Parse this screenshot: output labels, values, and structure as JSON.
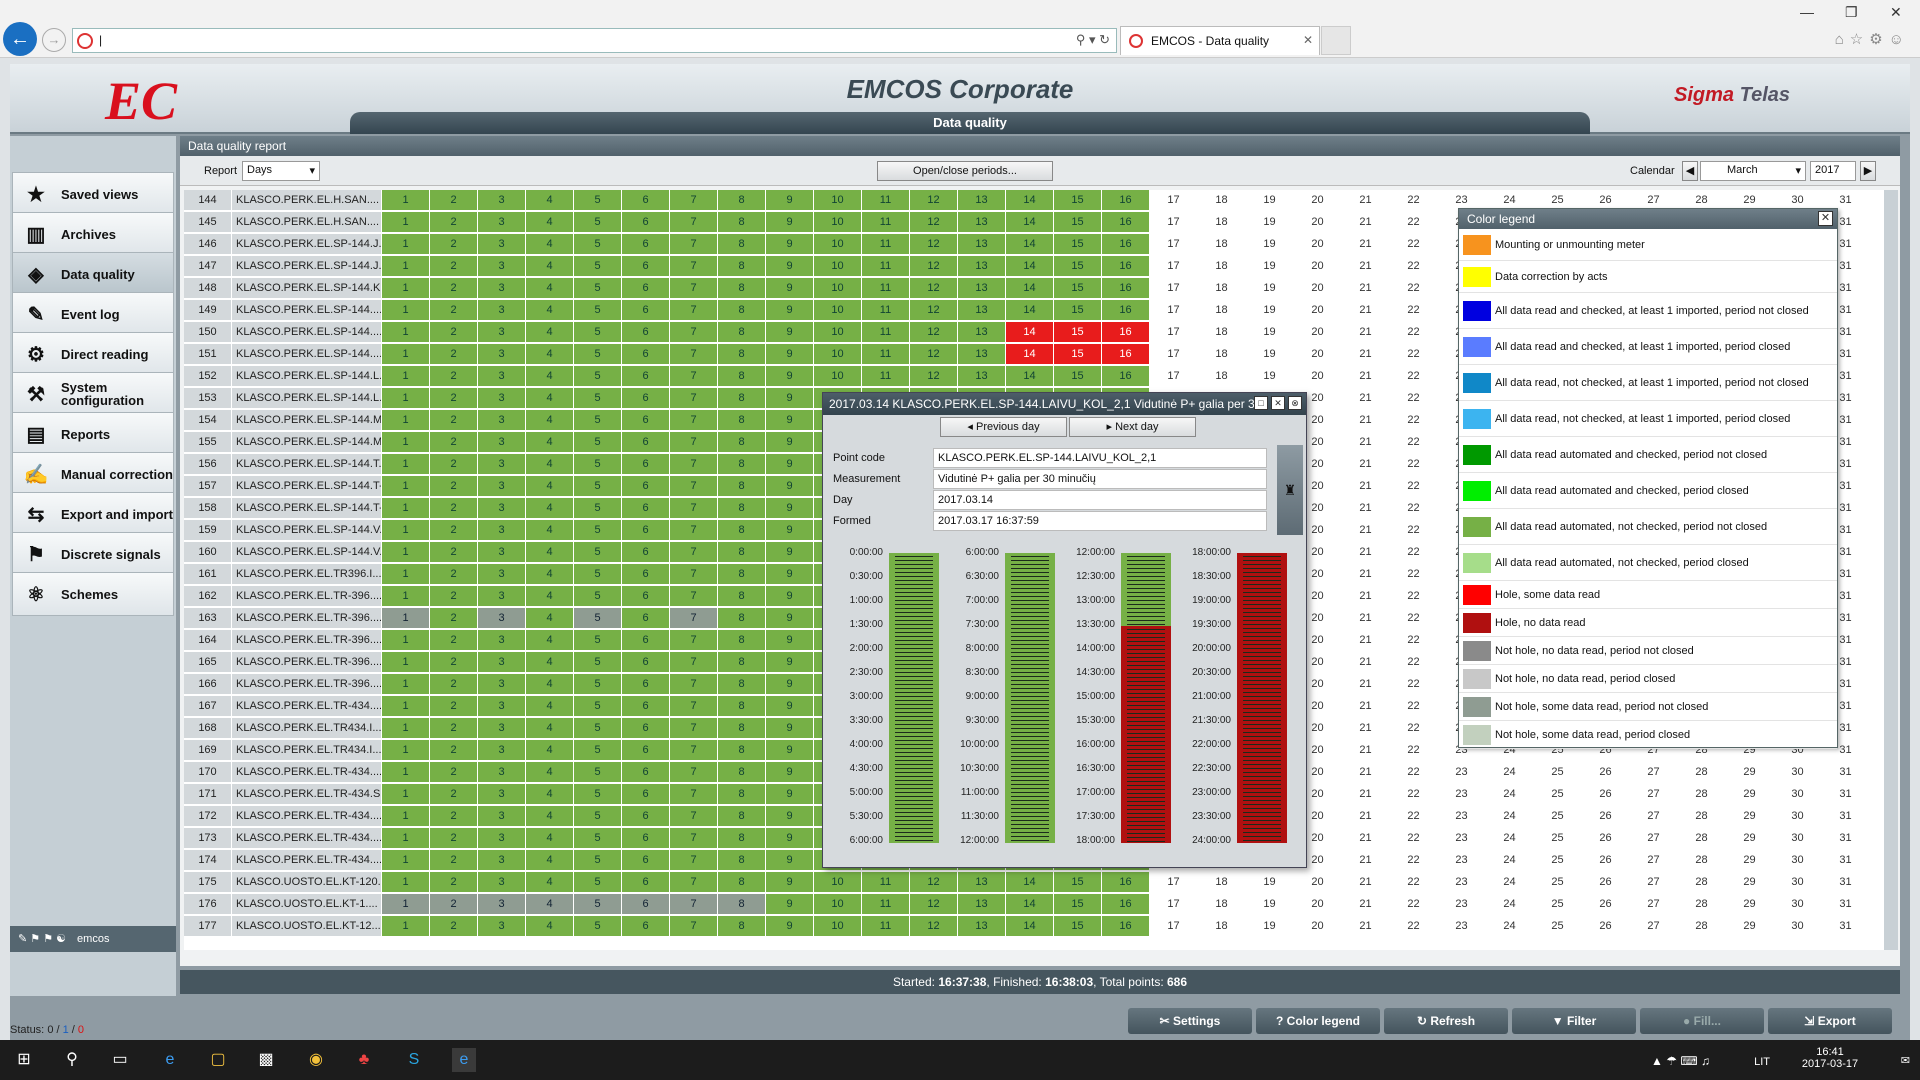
{
  "browser": {
    "tab_title": "EMCOS - Data quality",
    "address": "|"
  },
  "app": {
    "title": "EMCOS Corporate",
    "subtitle": "Data quality",
    "brand": "Sigma",
    "brand2": "Telas",
    "logo_text": "EC"
  },
  "sidebar": {
    "items": [
      {
        "label": "Saved views",
        "icon": "star-icon",
        "glyph": "★"
      },
      {
        "label": "Archives",
        "icon": "archives-icon",
        "glyph": "▥"
      },
      {
        "label": "Data quality",
        "icon": "data-quality-icon",
        "glyph": "◈"
      },
      {
        "label": "Event log",
        "icon": "event-log-icon",
        "glyph": "✎"
      },
      {
        "label": "Direct reading",
        "icon": "direct-reading-icon",
        "glyph": "⚙"
      },
      {
        "label": "System configuration",
        "icon": "system-configuration-icon",
        "glyph": "⚒"
      },
      {
        "label": "Reports",
        "icon": "reports-icon",
        "glyph": "▤"
      },
      {
        "label": "Manual correction",
        "icon": "manual-correction-icon",
        "glyph": "✍"
      },
      {
        "label": "Export and import",
        "icon": "export-import-icon",
        "glyph": "⇆"
      },
      {
        "label": "Discrete signals",
        "icon": "discrete-signals-icon",
        "glyph": "⚑"
      },
      {
        "label": "Schemes",
        "icon": "schemes-icon",
        "glyph": "⚛"
      }
    ],
    "user": "emcos"
  },
  "report": {
    "panel_title": "Data quality report",
    "report_label": "Report",
    "report_value": "Days",
    "open_close_label": "Open/close periods...",
    "calendar_label": "Calendar",
    "month": "March",
    "year": "2017"
  },
  "grid": {
    "rows": [
      {
        "n": "144",
        "name": "KLASCO.PERK.EL.H.SAN...."
      },
      {
        "n": "145",
        "name": "KLASCO.PERK.EL.H.SAN...."
      },
      {
        "n": "146",
        "name": "KLASCO.PERK.EL.SP-144.J..."
      },
      {
        "n": "147",
        "name": "KLASCO.PERK.EL.SP-144.J..."
      },
      {
        "n": "148",
        "name": "KLASCO.PERK.EL.SP-144.K..."
      },
      {
        "n": "149",
        "name": "KLASCO.PERK.EL.SP-144...."
      },
      {
        "n": "150",
        "name": "KLASCO.PERK.EL.SP-144...."
      },
      {
        "n": "151",
        "name": "KLASCO.PERK.EL.SP-144...."
      },
      {
        "n": "152",
        "name": "KLASCO.PERK.EL.SP-144.L..."
      },
      {
        "n": "153",
        "name": "KLASCO.PERK.EL.SP-144.L..."
      },
      {
        "n": "154",
        "name": "KLASCO.PERK.EL.SP-144.M..."
      },
      {
        "n": "155",
        "name": "KLASCO.PERK.EL.SP-144.M..."
      },
      {
        "n": "156",
        "name": "KLASCO.PERK.EL.SP-144.T..."
      },
      {
        "n": "157",
        "name": "KLASCO.PERK.EL.SP-144.T-1"
      },
      {
        "n": "158",
        "name": "KLASCO.PERK.EL.SP-144.T-2"
      },
      {
        "n": "159",
        "name": "KLASCO.PERK.EL.SP-144.V..."
      },
      {
        "n": "160",
        "name": "KLASCO.PERK.EL.SP-144.V..."
      },
      {
        "n": "161",
        "name": "KLASCO.PERK.EL.TR396.I..."
      },
      {
        "n": "162",
        "name": "KLASCO.PERK.EL.TR-396...."
      },
      {
        "n": "163",
        "name": "KLASCO.PERK.EL.TR-396...."
      },
      {
        "n": "164",
        "name": "KLASCO.PERK.EL.TR-396...."
      },
      {
        "n": "165",
        "name": "KLASCO.PERK.EL.TR-396...."
      },
      {
        "n": "166",
        "name": "KLASCO.PERK.EL.TR-396...."
      },
      {
        "n": "167",
        "name": "KLASCO.PERK.EL.TR-434...."
      },
      {
        "n": "168",
        "name": "KLASCO.PERK.EL.TR434.I..."
      },
      {
        "n": "169",
        "name": "KLASCO.PERK.EL.TR434.I..."
      },
      {
        "n": "170",
        "name": "KLASCO.PERK.EL.TR-434...."
      },
      {
        "n": "171",
        "name": "KLASCO.PERK.EL.TR-434.SI..."
      },
      {
        "n": "172",
        "name": "KLASCO.PERK.EL.TR-434...."
      },
      {
        "n": "173",
        "name": "KLASCO.PERK.EL.TR-434...."
      },
      {
        "n": "174",
        "name": "KLASCO.PERK.EL.TR-434...."
      },
      {
        "n": "175",
        "name": "KLASCO.UOSTO.EL.KT-120...."
      },
      {
        "n": "176",
        "name": "KLASCO.UOSTO.EL.KT-1...."
      },
      {
        "n": "177",
        "name": "KLASCO.UOSTO.EL.KT-12...."
      }
    ]
  },
  "legend": {
    "title": "Color legend",
    "items": [
      {
        "label": "Mounting or unmounting meter",
        "color": "#f7931e"
      },
      {
        "label": "Data correction by acts",
        "color": "#ffff00"
      },
      {
        "label": "All data read and checked, at least 1 imported, period not closed",
        "color": "#0000e0"
      },
      {
        "label": "All data read and checked, at least 1 imported, period closed",
        "color": "#5a7cff"
      },
      {
        "label": "All data read, not checked, at least 1 imported, period not closed",
        "color": "#1088c8"
      },
      {
        "label": "All data read, not checked, at least 1 imported, period closed",
        "color": "#3cb4f0"
      },
      {
        "label": "All data read automated and checked, period not closed",
        "color": "#009900"
      },
      {
        "label": "All data read automated and checked, period closed",
        "color": "#00ee00"
      },
      {
        "label": "All data read automated, not checked, period not closed",
        "color": "#76b046"
      },
      {
        "label": "All data read automated, not checked, period closed",
        "color": "#a6dd8a"
      },
      {
        "label": "Hole, some data read",
        "color": "#ff0000"
      },
      {
        "label": "Hole, no data read",
        "color": "#b01010"
      },
      {
        "label": "Not hole, no data read, period not closed",
        "color": "#8a8a8a"
      },
      {
        "label": "Not hole, no data read, period closed",
        "color": "#c8c8c8"
      },
      {
        "label": "Not hole, some data read, period not closed",
        "color": "#8f9c92"
      },
      {
        "label": "Not hole, some data read, period closed",
        "color": "#c2d0be"
      }
    ]
  },
  "dialog": {
    "title": "2017.03.14 KLASCO.PERK.EL.SP-144.LAIVU_KOL_2,1 Vidutinė P+ galia per 3",
    "prev_label": "Previous day",
    "next_label": "Next day",
    "point_code_label": "Point code",
    "point_code": "KLASCO.PERK.EL.SP-144.LAIVU_KOL_2,1",
    "measurement_label": "Measurement",
    "measurement": "Vidutinė P+ galia per 30 minučių",
    "day_label": "Day",
    "day": "2017.03.14",
    "formed_label": "Formed",
    "formed": "2017.03.17 16:37:59",
    "columns": [
      {
        "ticks": [
          "0:00:00",
          "0:30:00",
          "1:00:00",
          "1:30:00",
          "2:00:00",
          "2:30:00",
          "3:00:00",
          "3:30:00",
          "4:00:00",
          "4:30:00",
          "5:00:00",
          "5:30:00",
          "6:00:00"
        ],
        "green_fraction": 1
      },
      {
        "ticks": [
          "6:00:00",
          "6:30:00",
          "7:00:00",
          "7:30:00",
          "8:00:00",
          "8:30:00",
          "9:00:00",
          "9:30:00",
          "10:00:00",
          "10:30:00",
          "11:00:00",
          "11:30:00",
          "12:00:00"
        ],
        "green_fraction": 1
      },
      {
        "ticks": [
          "12:00:00",
          "12:30:00",
          "13:00:00",
          "13:30:00",
          "14:00:00",
          "14:30:00",
          "15:00:00",
          "15:30:00",
          "16:00:00",
          "16:30:00",
          "17:00:00",
          "17:30:00",
          "18:00:00"
        ],
        "green_fraction": 0.25
      },
      {
        "ticks": [
          "18:00:00",
          "18:30:00",
          "19:00:00",
          "19:30:00",
          "20:00:00",
          "20:30:00",
          "21:00:00",
          "21:30:00",
          "22:00:00",
          "22:30:00",
          "23:00:00",
          "23:30:00",
          "24:00:00"
        ],
        "green_fraction": 0
      }
    ]
  },
  "status": {
    "started_label": "Started:",
    "started": "16:37:38",
    "finished_label": "Finished:",
    "finished": "16:38:03",
    "total_label": "Total points:",
    "total": "686"
  },
  "bottom_buttons": [
    "Settings",
    "Color legend",
    "Refresh",
    "Filter",
    "Fill...",
    "Export"
  ],
  "status_line": {
    "label": "Status:",
    "a": "0",
    "b": "1",
    "c": "0"
  },
  "taskbar": {
    "time": "16:41",
    "date": "2017-03-17",
    "lang": "LIT"
  }
}
